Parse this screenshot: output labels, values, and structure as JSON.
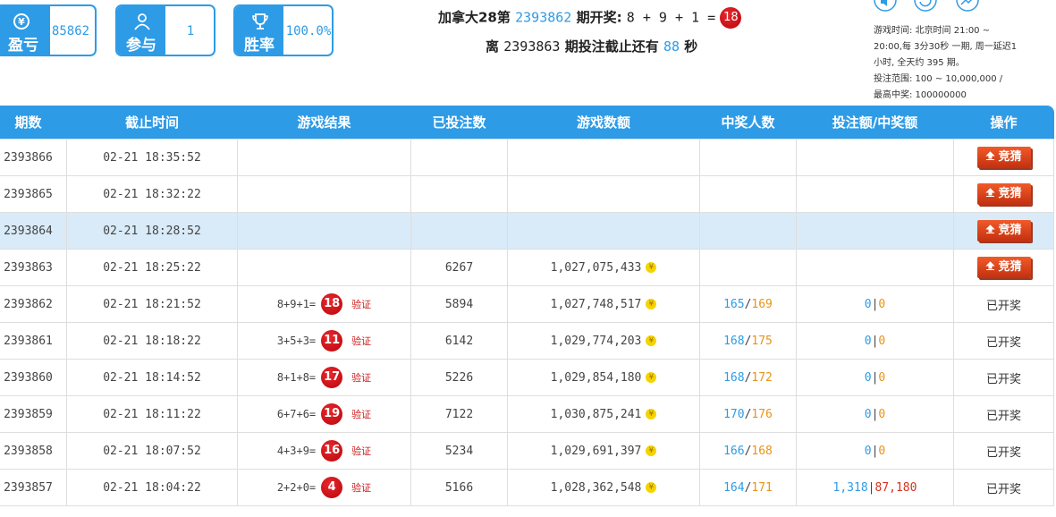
{
  "stats": {
    "profit": {
      "label": "盈亏",
      "value": "85862"
    },
    "joined": {
      "label": "参与",
      "value": "1"
    },
    "winrate": {
      "label": "胜率",
      "value": "100.0%"
    }
  },
  "headline": {
    "prefix": "加拿大28第",
    "period": "2393862",
    "suffix": "期开奖:",
    "formula": "8 + 9 + 1 =",
    "result": "18"
  },
  "countdown": {
    "prefix": "离",
    "period": "2393863",
    "middle": "期投注截止还有",
    "seconds": "88",
    "suffix": "秒"
  },
  "info": {
    "line1": "游戏时间: 北京时间 21:00 ~",
    "line2": "20:00,每 3分30秒 一期, 周一延迟1",
    "line3": "小时, 全天约 395 期。",
    "line4": "投注范围: 100 ~ 10,000,000 /",
    "line5": "最高中奖: 100000000"
  },
  "table": {
    "headers": [
      "期数",
      "截止时间",
      "游戏结果",
      "已投注数",
      "游戏数额",
      "中奖人数",
      "投注额/中奖额",
      "操作"
    ],
    "bet_button": "竞猜",
    "verify_label": "验证",
    "opened_label": "已开奖",
    "coin_symbol": "¥",
    "rows": [
      {
        "period": "2393866",
        "time": "02-21 18:35:52",
        "eq": "",
        "result": "",
        "bets": "",
        "amount": "",
        "winners": "",
        "players": "",
        "bet": "",
        "win": "",
        "action": "bet"
      },
      {
        "period": "2393865",
        "time": "02-21 18:32:22",
        "eq": "",
        "result": "",
        "bets": "",
        "amount": "",
        "winners": "",
        "players": "",
        "bet": "",
        "win": "",
        "action": "bet"
      },
      {
        "period": "2393864",
        "time": "02-21 18:28:52",
        "eq": "",
        "result": "",
        "bets": "",
        "amount": "",
        "winners": "",
        "players": "",
        "bet": "",
        "win": "",
        "action": "bet",
        "highlight": true
      },
      {
        "period": "2393863",
        "time": "02-21 18:25:22",
        "eq": "",
        "result": "",
        "bets": "6267",
        "amount": "1,027,075,433",
        "winners": "",
        "players": "",
        "bet": "",
        "win": "",
        "action": "bet"
      },
      {
        "period": "2393862",
        "time": "02-21 18:21:52",
        "eq": "8+9+1=",
        "result": "18",
        "bets": "5894",
        "amount": "1,027,748,517",
        "winners": "165",
        "players": "169",
        "bet": "0",
        "win": "0",
        "action": "opened"
      },
      {
        "period": "2393861",
        "time": "02-21 18:18:22",
        "eq": "3+5+3=",
        "result": "11",
        "bets": "6142",
        "amount": "1,029,774,203",
        "winners": "168",
        "players": "175",
        "bet": "0",
        "win": "0",
        "action": "opened"
      },
      {
        "period": "2393860",
        "time": "02-21 18:14:52",
        "eq": "8+1+8=",
        "result": "17",
        "bets": "5226",
        "amount": "1,029,854,180",
        "winners": "168",
        "players": "172",
        "bet": "0",
        "win": "0",
        "action": "opened"
      },
      {
        "period": "2393859",
        "time": "02-21 18:11:22",
        "eq": "6+7+6=",
        "result": "19",
        "bets": "7122",
        "amount": "1,030,875,241",
        "winners": "170",
        "players": "176",
        "bet": "0",
        "win": "0",
        "action": "opened"
      },
      {
        "period": "2393858",
        "time": "02-21 18:07:52",
        "eq": "4+3+9=",
        "result": "16",
        "bets": "5234",
        "amount": "1,029,691,397",
        "winners": "166",
        "players": "168",
        "bet": "0",
        "win": "0",
        "action": "opened"
      },
      {
        "period": "2393857",
        "time": "02-21 18:04:22",
        "eq": "2+2+0=",
        "result": "4",
        "bets": "5166",
        "amount": "1,028,362,548",
        "winners": "164",
        "players": "171",
        "bet": "1,318",
        "win": "87,180",
        "action": "opened"
      }
    ]
  }
}
